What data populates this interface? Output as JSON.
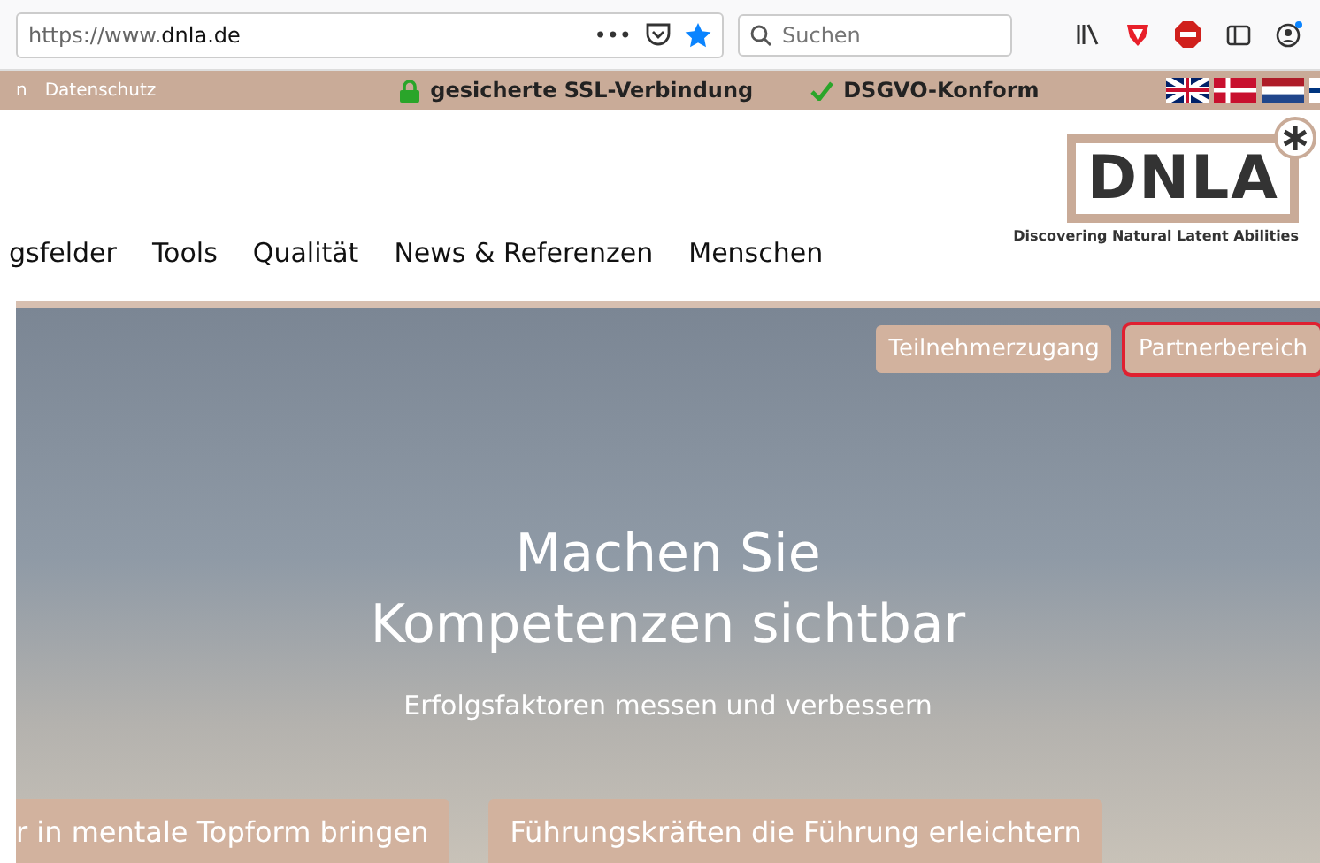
{
  "browser": {
    "url_scheme": "https://www.",
    "url_host": "dnla.de",
    "page_actions": "•••",
    "search": {
      "placeholder": "Suchen"
    }
  },
  "top_bar": {
    "links": [
      "n",
      "Datenschutz"
    ],
    "badges": [
      {
        "kind": "lock",
        "label": "gesicherte SSL-Verbindung"
      },
      {
        "kind": "check",
        "label": "DSGVO-Konform"
      }
    ]
  },
  "header": {
    "nav": [
      "gsfelder",
      "Tools",
      "Qualität",
      "News & Referenzen",
      "Menschen"
    ],
    "logo": {
      "text": "DNLA",
      "tagline": "Discovering Natural Latent Abilities"
    }
  },
  "hero": {
    "buttons": [
      {
        "label": "Teilnehmerzugang",
        "highlighted": false
      },
      {
        "label": "Partnerbereich",
        "highlighted": true
      }
    ],
    "headline": [
      "Machen Sie",
      "Kompetenzen sichtbar"
    ],
    "subline": "Erfolgsfaktoren messen und verbessern",
    "cards": [
      "r in mentale Topform bringen",
      "Führungskräften die Führung erleichtern"
    ]
  }
}
